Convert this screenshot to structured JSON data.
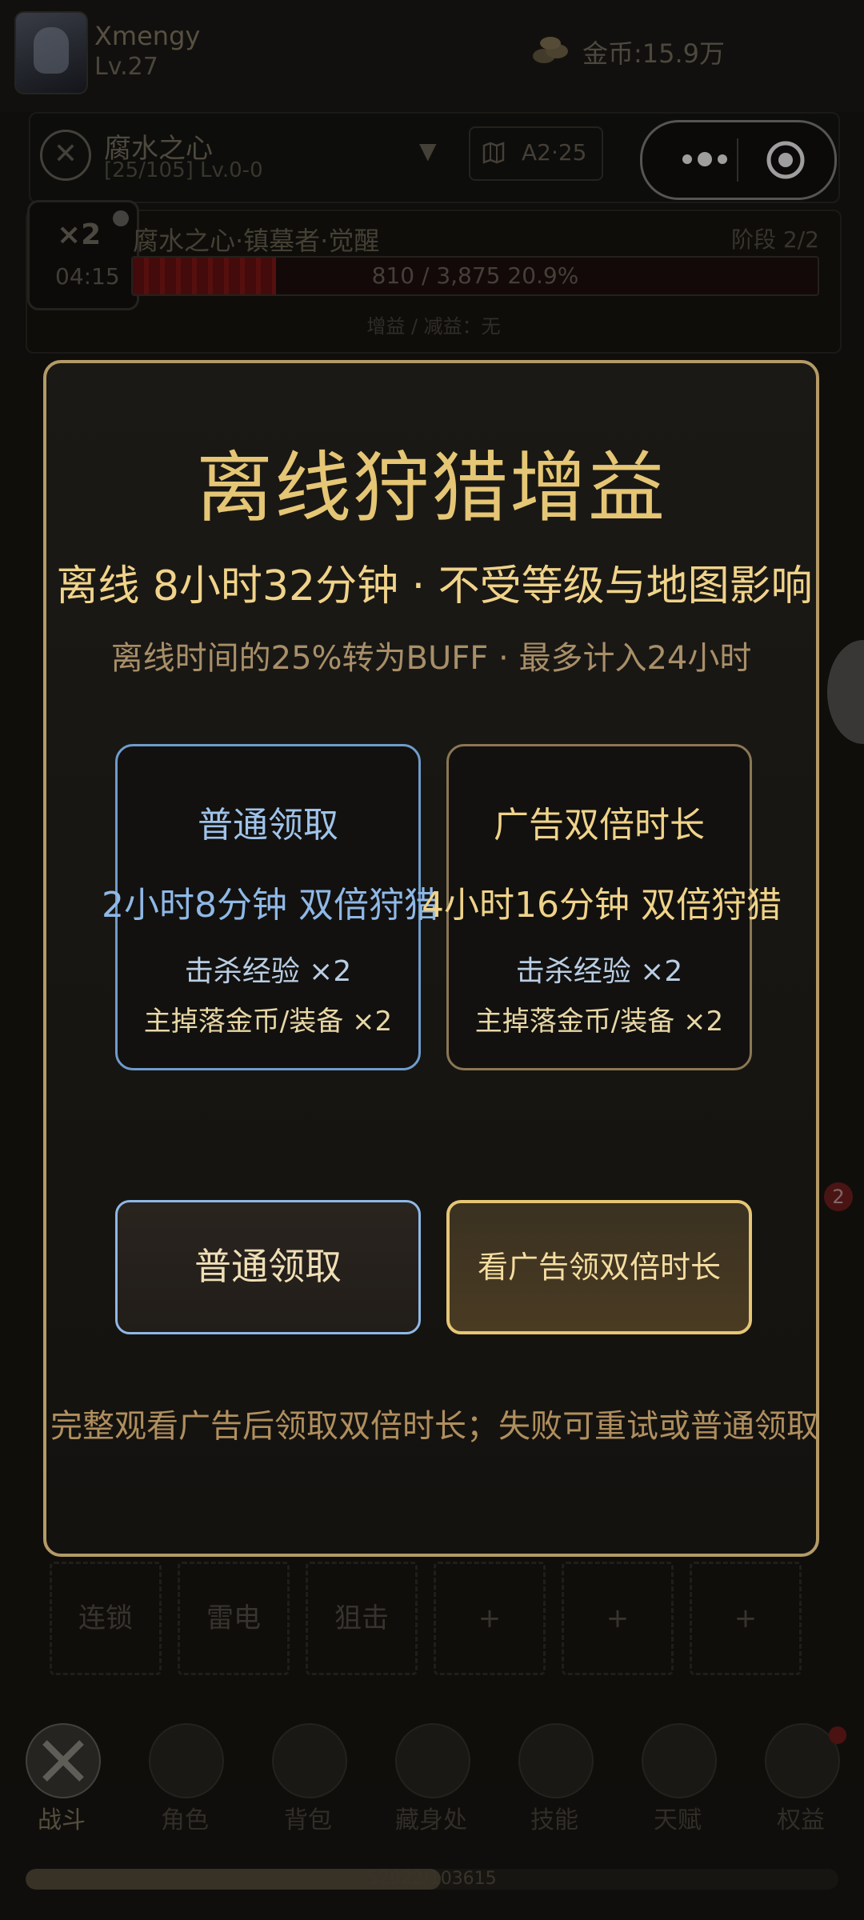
{
  "header": {
    "username": "Xmengy",
    "level": "Lv.27",
    "coins": "金币:15.9万"
  },
  "boss": {
    "name": "腐水之心",
    "sub": "[25/105] Lv.0-0",
    "map_label": "A2·25"
  },
  "stage": {
    "multiplier": "×2",
    "timer": "04:15",
    "title": "腐水之心·镇墓者·觉醒",
    "phase": "阶段 2/2",
    "hp_text": "810 / 3,875   20.9%",
    "hp_fraction": 0.209,
    "buff": "增益 / 减益：无"
  },
  "modal": {
    "title": "离线狩猎增益",
    "offline": "离线 8小时32分钟 · 不受等级与地图影响",
    "note": "离线时间的25%转为BUFF · 最多计入24小时",
    "normal_card": {
      "title": "普通领取",
      "duration": "2小时8分钟 双倍狩猎",
      "line1": "击杀经验 ×2",
      "line2": "主掉落金币/装备 ×2"
    },
    "ad_card": {
      "title": "广告双倍时长",
      "duration": "4小时16分钟 双倍狩猎",
      "line1": "击杀经验 ×2",
      "line2": "主掉落金币/装备 ×2"
    },
    "normal_button": "普通领取",
    "ad_button": "看广告领双倍时长",
    "footer": "完整观看广告后领取双倍时长；失败可重试或普通领取"
  },
  "badge_count": "2",
  "skills": [
    "连锁",
    "雷电",
    "狙击",
    "+",
    "+",
    "+"
  ],
  "nav": [
    {
      "label": "战斗",
      "icon": "swords-icon",
      "active": true
    },
    {
      "label": "角色",
      "icon": "character-icon",
      "active": false
    },
    {
      "label": "背包",
      "icon": "backpack-icon",
      "active": false
    },
    {
      "label": "藏身处",
      "icon": "hideout-icon",
      "active": false
    },
    {
      "label": "技能",
      "icon": "book-icon",
      "active": false
    },
    {
      "label": "天赋",
      "icon": "talent-icon",
      "active": false
    },
    {
      "label": "权益",
      "icon": "crown-icon",
      "active": false
    }
  ],
  "xp": {
    "text": "52922/103615",
    "fraction": 0.511
  },
  "colors": {
    "gold": "#e5c675",
    "blue": "#8fb8e6",
    "border_gold": "#b49a66"
  }
}
